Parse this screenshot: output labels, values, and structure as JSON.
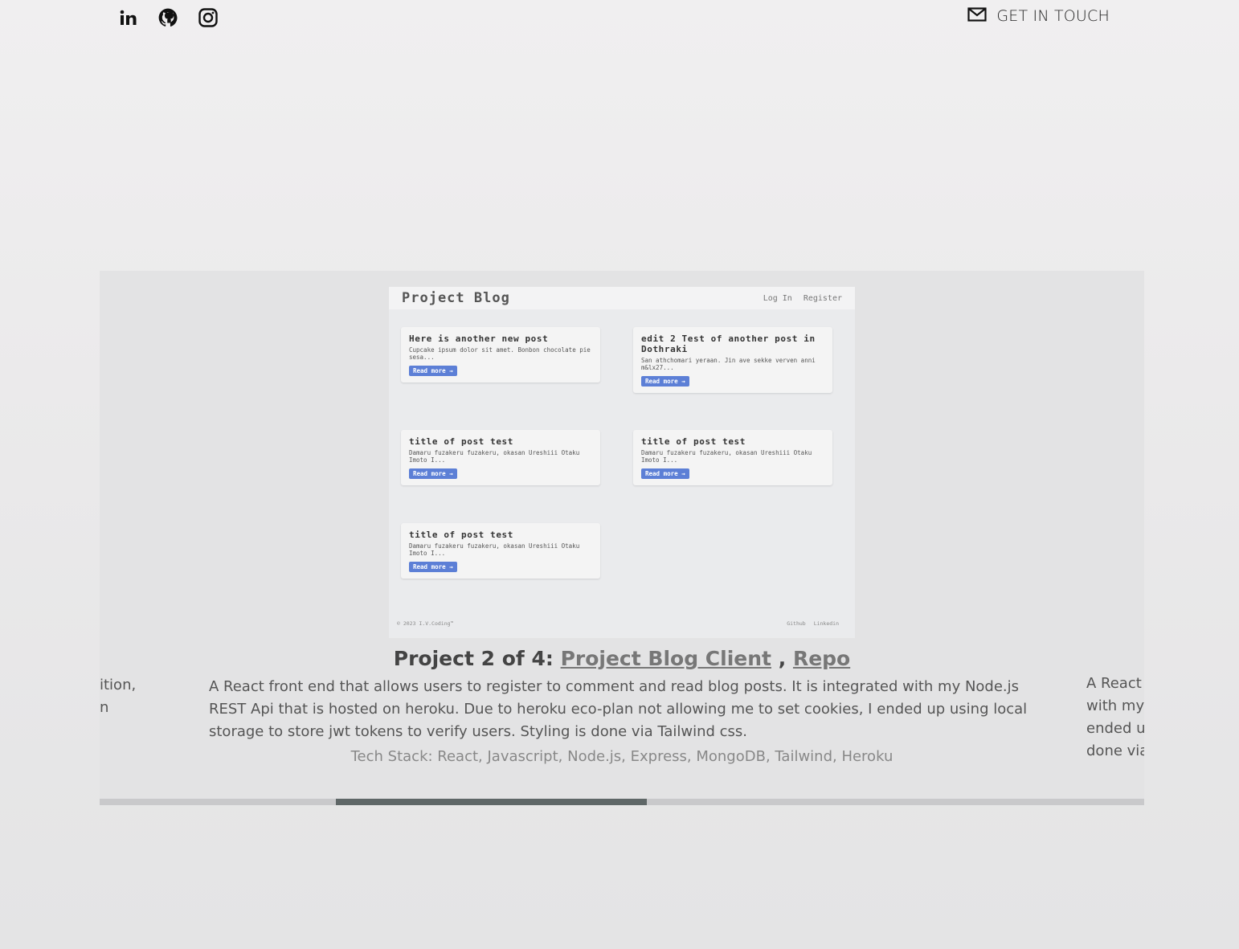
{
  "header": {
    "social": [
      {
        "name": "linkedin-icon",
        "label": "in"
      },
      {
        "name": "github-icon",
        "label": ""
      },
      {
        "name": "instagram-icon",
        "label": ""
      }
    ],
    "contact_label": "GET IN TOUCH",
    "contact_icon": "mail-icon"
  },
  "carousel": {
    "prev_peek": [
      "ition,",
      "n"
    ],
    "next_peek": [
      "A React",
      "with my",
      "ended u",
      "done via"
    ],
    "screenshot": {
      "brand": "Project Blog",
      "nav_links": [
        "Log In",
        "Register"
      ],
      "cards": [
        {
          "title": "Here is another new post",
          "excerpt": "Cupcake ipsum dolor sit amet. Bonbon chocolate pie sesa...",
          "button": "Read more →"
        },
        {
          "title": "edit 2 Test of another post in Dothraki",
          "excerpt": "San athchomari yeraan. Jin ave sekke verven anni m&lx27...",
          "button": "Read more →"
        },
        {
          "title": "title of post test",
          "excerpt": "Damaru fuzakeru fuzakeru, okasan Ureshiii Otaku Imoto I...",
          "button": "Read more →"
        },
        {
          "title": "title of post test",
          "excerpt": "Damaru fuzakeru fuzakeru, okasan Ureshiii Otaku Imoto I...",
          "button": "Read more →"
        },
        {
          "title": "title of post test",
          "excerpt": "Damaru fuzakeru fuzakeru, okasan Ureshiii Otaku Imoto I...",
          "button": "Read more →"
        }
      ],
      "footer_copy": "© 2023 I.V.Coding™",
      "footer_links": [
        "Github",
        "Linkedin"
      ]
    },
    "caption_prefix": "Project 2 of 4:",
    "caption_link": "Project Blog Client",
    "caption_sep": ",",
    "caption_repo": "Repo",
    "description": "A React front end that allows users to register to comment and read blog posts. It is integrated with my Node.js REST Api that is hosted on heroku. Due to heroku eco-plan not allowing me to set cookies, I ended up using local storage to store jwt tokens to verify users. Styling is done via Tailwind css.",
    "tech_stack": "Tech Stack: React, Javascript, Node.js, Express, MongoDB, Tailwind, Heroku",
    "progress": {
      "current": 2,
      "total": 4
    }
  }
}
